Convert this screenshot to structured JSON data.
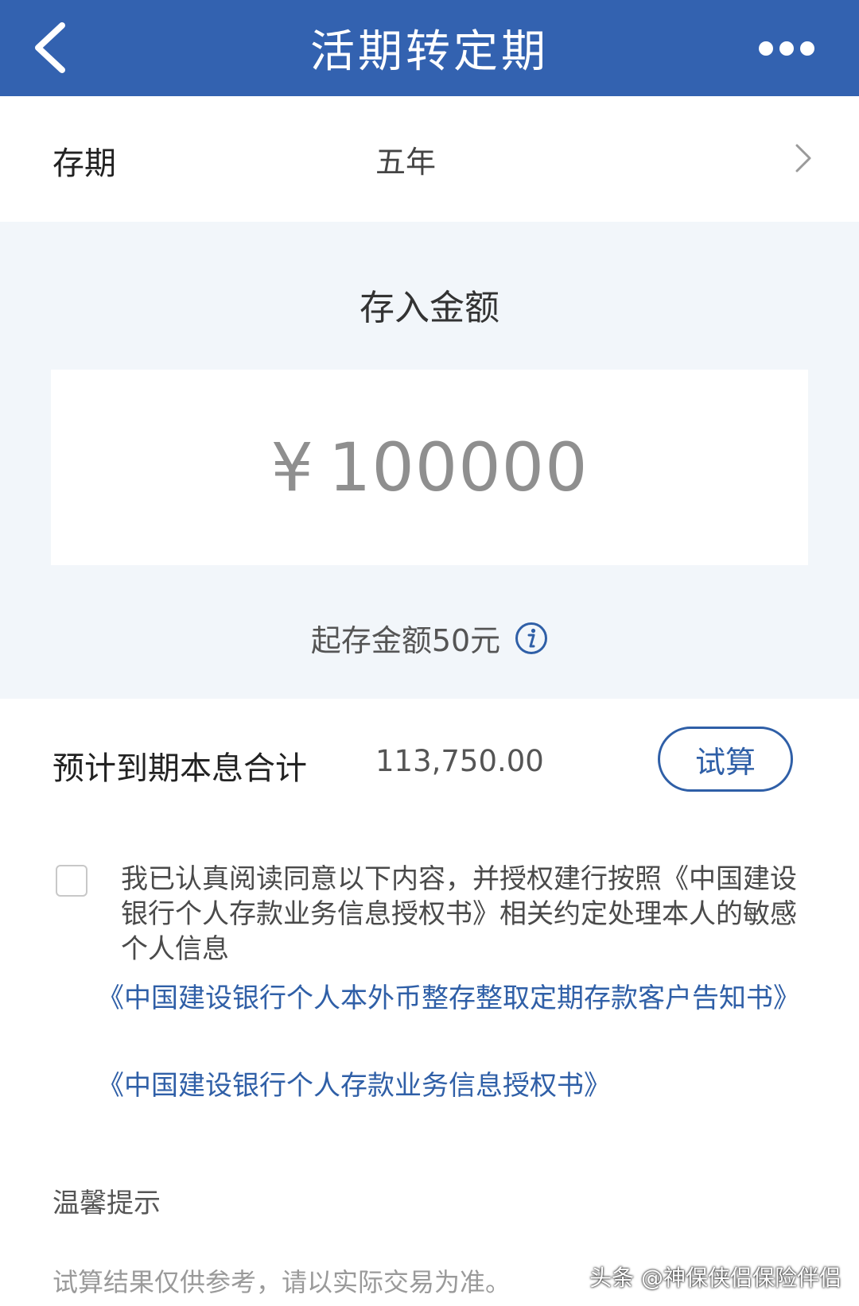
{
  "header": {
    "title": "活期转定期",
    "back_icon": "chevron-left-icon",
    "more_icon": "more-dots-icon"
  },
  "term": {
    "label": "存期",
    "value": "五年",
    "chevron_icon": "chevron-right-icon"
  },
  "amount": {
    "title": "存入金额",
    "currency": "¥",
    "value": "100000",
    "min_text": "起存金额50元",
    "info_icon": "info-icon"
  },
  "estimate": {
    "label": "预计到期本息合计",
    "value": "113,750.00",
    "calc_button": "试算"
  },
  "agreement": {
    "checked": false,
    "text": "我已认真阅读同意以下内容，并授权建行按照《中国建设银行个人存款业务信息授权书》相关约定处理本人的敏感个人信息",
    "link1": "《中国建设银行个人本外币整存整取定期存款客户告知书》",
    "link2": "《中国建设银行个人存款业务信息授权书》"
  },
  "tips": {
    "title": "温馨提示",
    "text": "试算结果仅供参考，请以实际交易为准。"
  },
  "watermark": "头条 @神保侠侣保险伴侣",
  "colors": {
    "header_bg": "#3362b0",
    "accent": "#2f5fa7",
    "section_bg": "#f2f6fa"
  }
}
